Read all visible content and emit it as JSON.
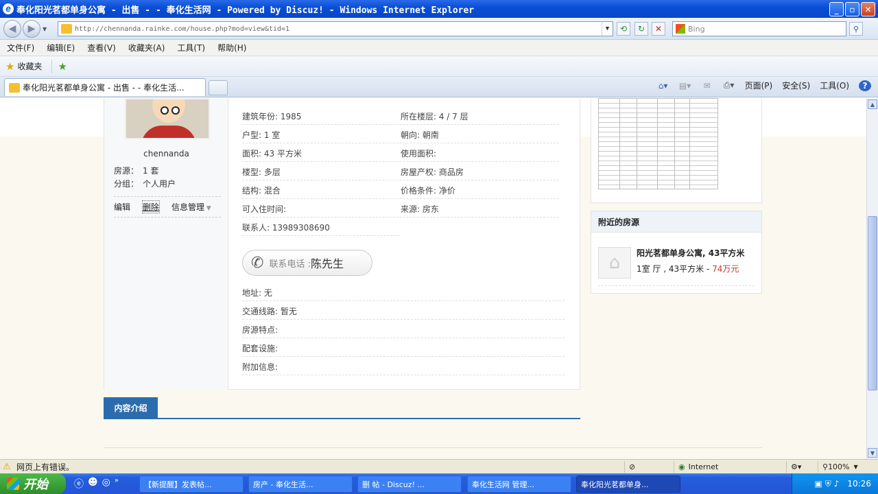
{
  "window": {
    "title": "奉化阳光茗都单身公寓 - 出售 - - 奉化生活网 - Powered by Discuz! - Windows Internet Explorer",
    "ie_glyph": "e",
    "minimize": "_",
    "restore": "▫",
    "close": "✕"
  },
  "addressbar": {
    "url": "http://chennanda.rainke.com/house.php?mod=view&tid=1",
    "search_placeholder": "Bing"
  },
  "menu": [
    "文件(F)",
    "编辑(E)",
    "查看(V)",
    "收藏夹(A)",
    "工具(T)",
    "帮助(H)"
  ],
  "favorites": {
    "label": "收藏夹"
  },
  "tab": {
    "title": "奉化阳光茗都单身公寓 - 出售 - - 奉化生活..."
  },
  "commandbar": {
    "page": "页面(P)",
    "safety": "安全(S)",
    "tools": "工具(O)",
    "help": "?"
  },
  "poster": {
    "username": "chennanda",
    "listings_label": "房源：",
    "listings_value": "1 套",
    "group_label": "分组：",
    "group_value": "个人用户",
    "actions": [
      "编辑",
      "删除",
      "信息管理"
    ]
  },
  "details": {
    "year": "建筑年份: 1985",
    "floor": "所在楼层: 4 / 7 层",
    "layout": "户型: 1 室",
    "facing": "朝向: 朝南",
    "area": "面积: 43 平方米",
    "usable": "使用面积:",
    "type": "楼型: 多层",
    "ownership": "房屋产权: 商品房",
    "structure": "结构: 混合",
    "price_terms": "价格条件: 净价",
    "movein": "可入住时间:",
    "source": "来源: 房东",
    "contact": "联系人: 13989308690",
    "address": "地址: 无",
    "traffic": "交通线路: 暂无",
    "features": "房源特点:",
    "facilities": "配套设施:",
    "extra": "附加信息:"
  },
  "phone": {
    "label": "联系电话 : ",
    "name": "陈先生"
  },
  "content_tab": "内容介绍",
  "nearby": {
    "header": "附近的房源",
    "item_title": "阳光茗都单身公寓, 43平方米",
    "item_desc": "1室 厅 , 43平方米 - ",
    "item_price": "74万元"
  },
  "status": {
    "error_text": "网页上有错误。",
    "zone": "Internet",
    "zoom": "100%"
  },
  "taskbar": {
    "start": "开始",
    "tasks": [
      "【新提醒】发表帖...",
      "房产 - 奉化生活...",
      "删 帖 - Discuz! ...",
      "奉化生活网 管理...",
      "奉化阳光茗都单身..."
    ],
    "time": "10:26"
  }
}
